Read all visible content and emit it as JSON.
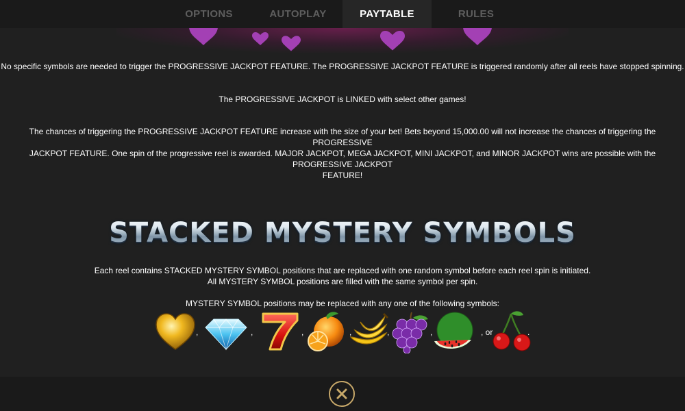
{
  "tabs": [
    {
      "label": "OPTIONS"
    },
    {
      "label": "AUTOPLAY"
    },
    {
      "label": "PAYTABLE"
    },
    {
      "label": "RULES"
    }
  ],
  "progressive": {
    "trigger_text": "No specific symbols are needed to trigger the PROGRESSIVE JACKPOT FEATURE. The PROGRESSIVE JACKPOT FEATURE is triggered randomly after all reels have stopped spinning.",
    "linked_text": "The PROGRESSIVE JACKPOT is LINKED with select other games!",
    "chances_line1": "The chances of triggering the PROGRESSIVE JACKPOT FEATURE increase with the size of your bet! Bets beyond 15,000.00 will not increase the chances of triggering the PROGRESSIVE",
    "chances_line2": "JACKPOT FEATURE. One spin of the progressive reel is awarded. MAJOR JACKPOT, MEGA JACKPOT, MINI JACKPOT, and MINOR JACKPOT wins are possible with the PROGRESSIVE JACKPOT",
    "chances_line3": "FEATURE!"
  },
  "mystery": {
    "title": "STACKED MYSTERY SYMBOLS",
    "desc_line1": "Each reel contains STACKED MYSTERY SYMBOL positions that are replaced with one random symbol before each reel spin is initiated.",
    "desc_line2": "All MYSTERY SYMBOL positions are filled with the same symbol per spin.",
    "replace_text": "MYSTERY SYMBOL positions may be replaced with any one of the following symbols:",
    "separators": [
      ",",
      ",",
      ",",
      ",",
      ",",
      ",",
      ", or",
      "."
    ],
    "symbols": [
      "gold-heart-icon",
      "diamond-icon",
      "seven-icon",
      "orange-icon",
      "banana-icon",
      "grapes-icon",
      "watermelon-icon",
      "cherries-icon"
    ]
  },
  "close": {
    "icon": "close-icon",
    "color": "#c8a96a"
  }
}
